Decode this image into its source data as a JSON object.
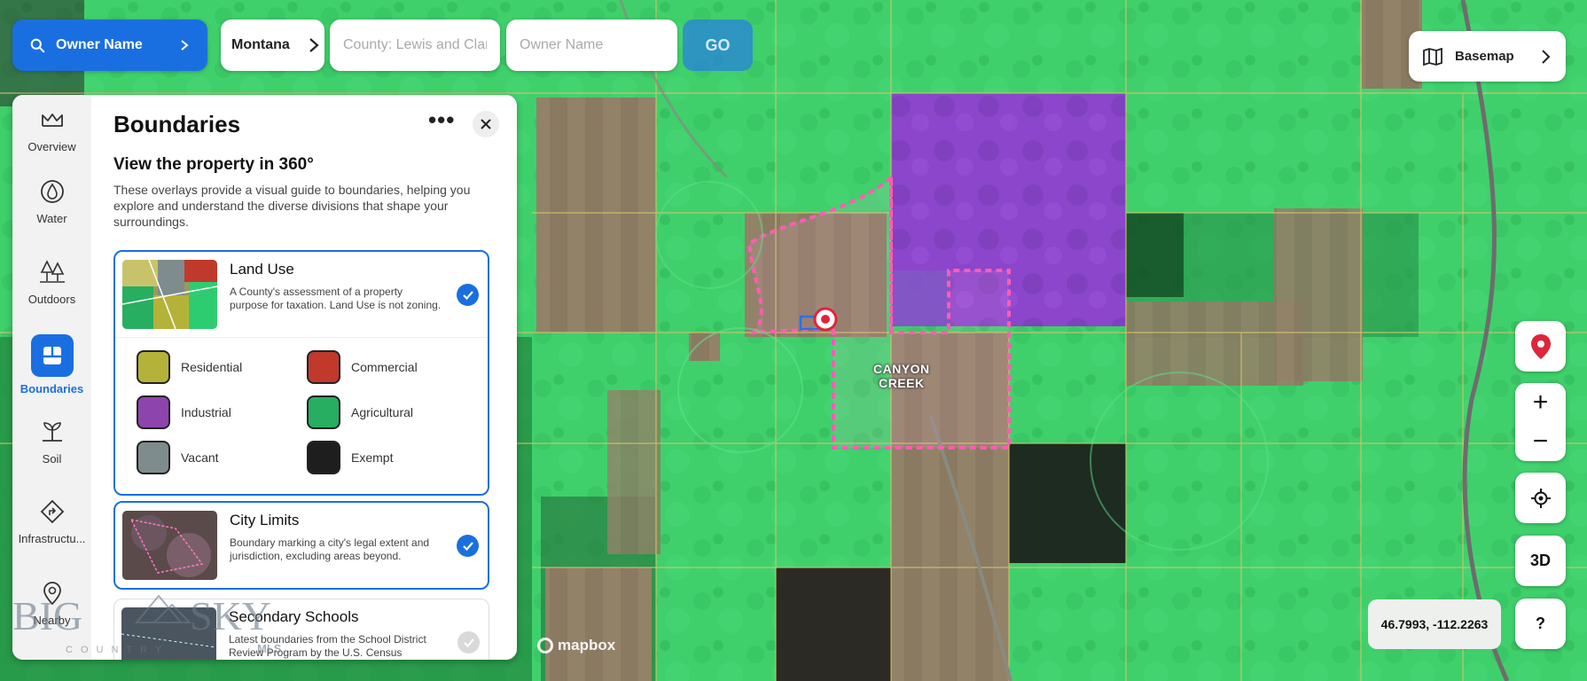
{
  "topbar": {
    "owner_button_label": "Owner Name",
    "state_label": "Montana",
    "county_placeholder": "County: Lewis and Clark",
    "owner_placeholder": "Owner Name",
    "go_label": "GO"
  },
  "basemap": {
    "label": "Basemap"
  },
  "map": {
    "place_label_line1": "CANYON",
    "place_label_line2": "CREEK",
    "attribution": "mapbox",
    "coordinates": "46.7993, -112.2263",
    "button_3d": "3D",
    "button_help": "?",
    "zoom_in": "+",
    "zoom_out": "−"
  },
  "sidebar": {
    "items": [
      {
        "label": "Overview",
        "icon": "crown-icon"
      },
      {
        "label": "Water",
        "icon": "water-drop-icon"
      },
      {
        "label": "Outdoors",
        "icon": "trees-icon"
      },
      {
        "label": "Boundaries",
        "icon": "boundaries-icon",
        "active": true
      },
      {
        "label": "Soil",
        "icon": "plant-icon"
      },
      {
        "label": "Infrastructu...",
        "icon": "road-sign-icon"
      },
      {
        "label": "Nearby",
        "icon": "location-pin-icon"
      }
    ]
  },
  "panel": {
    "title": "Boundaries",
    "subtitle": "View the property in 360°",
    "description": "These overlays provide a visual guide to boundaries, helping you explore and understand the diverse divisions that shape your surroundings.",
    "cards": [
      {
        "title": "Land Use",
        "description": "A County's assessment of a property purpose for taxation. Land Use is not zoning.",
        "checked": true,
        "legend": [
          {
            "label": "Residential",
            "color": "#b5b23a"
          },
          {
            "label": "Commercial",
            "color": "#c0392b"
          },
          {
            "label": "Industrial",
            "color": "#8e44ad"
          },
          {
            "label": "Agricultural",
            "color": "#27ae60"
          },
          {
            "label": "Vacant",
            "color": "#7f8c8d"
          },
          {
            "label": "Exempt",
            "color": "#1e1e1e"
          }
        ]
      },
      {
        "title": "City Limits",
        "description": "Boundary marking a city's legal extent and jurisdiction, excluding areas beyond.",
        "checked": true
      },
      {
        "title": "Secondary Schools",
        "description": "Latest boundaries from the School District Review Program by the U.S. Census",
        "checked": false
      }
    ]
  },
  "watermark": {
    "text": "BIG SKY",
    "sub": "COUNTRY",
    "tag": "MLS"
  },
  "colors": {
    "accent": "#1a6fe0",
    "agricultural_overlay": "#2ecc71",
    "industrial_overlay": "#9b3fd6",
    "city_limit": "#ff4fa8",
    "pin": "#e0243c"
  }
}
